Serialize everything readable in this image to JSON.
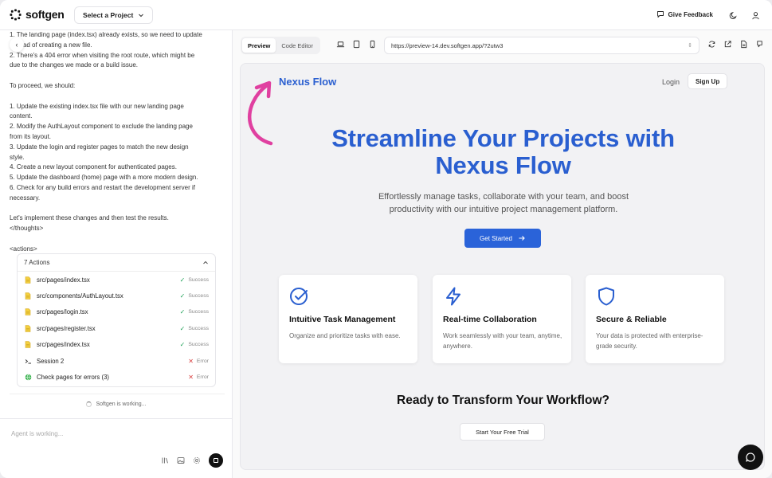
{
  "app": {
    "logo_text": "softgen",
    "project_select": "Select a Project",
    "give_feedback": "Give Feedback"
  },
  "chat": {
    "lines": [
      "1. The landing page (index.tsx) already exists, so we need to update",
      "instead of creating a new file.",
      "2. There's a 404 error when visiting the root route, which might be",
      "due to the changes we made or a build issue.",
      "",
      "To proceed, we should:",
      "",
      "1. Update the existing index.tsx file with our new landing page",
      "content.",
      "2. Modify the AuthLayout component to exclude the landing page",
      "from its layout.",
      "3. Update the login and register pages to match the new design",
      "style.",
      "4. Create a new layout component for authenticated pages.",
      "5. Update the dashboard (home) page with a more modern design.",
      "6. Check for any build errors and restart the development server if",
      "necessary.",
      "",
      "Let's implement these changes and then test the results.",
      "</thoughts>",
      "",
      "<actions>"
    ],
    "actions_title": "7 Actions",
    "actions": [
      {
        "icon": "file-icon",
        "path": "src/pages/index.tsx",
        "status": "Success",
        "ok": true
      },
      {
        "icon": "file-icon",
        "path": "src/components/AuthLayout.tsx",
        "status": "Success",
        "ok": true
      },
      {
        "icon": "file-icon",
        "path": "src/pages/login.tsx",
        "status": "Success",
        "ok": true
      },
      {
        "icon": "file-icon",
        "path": "src/pages/register.tsx",
        "status": "Success",
        "ok": true
      },
      {
        "icon": "file-icon",
        "path": "src/pages/index.tsx",
        "status": "Success",
        "ok": true
      },
      {
        "icon": "terminal-icon",
        "path": "Session 2",
        "status": "Error",
        "ok": false
      },
      {
        "icon": "globe-icon",
        "path": "Check pages for errors (3)",
        "status": "Error",
        "ok": false
      }
    ],
    "working_status": "Softgen is working...",
    "input_placeholder": "Agent is working..."
  },
  "preview_toolbar": {
    "tab_preview": "Preview",
    "tab_code": "Code Editor",
    "url": "https://preview-14.dev.softgen.app/?2utw3"
  },
  "site": {
    "brand": "Nexus Flow",
    "login": "Login",
    "signup": "Sign Up",
    "hero_line1": "Streamline Your Projects with",
    "hero_line2": "Nexus Flow",
    "subtitle_line1": "Effortlessly manage tasks, collaborate with your team, and boost",
    "subtitle_line2": "productivity with our intuitive project management platform.",
    "cta": "Get Started",
    "features": [
      {
        "icon": "check-circle-icon",
        "title": "Intuitive Task Management",
        "desc": "Organize and prioritize tasks with ease."
      },
      {
        "icon": "lightning-icon",
        "title": "Real-time Collaboration",
        "desc": "Work seamlessly with your team, anytime, anywhere."
      },
      {
        "icon": "shield-icon",
        "title": "Secure & Reliable",
        "desc": "Your data is protected with enterprise-grade security."
      }
    ],
    "ready_title": "Ready to Transform Your Workflow?",
    "trial_button": "Start Your Free Trial"
  },
  "colors": {
    "brand_blue": "#2a5fd0",
    "arrow_pink": "#e040a0",
    "success": "#22a35a",
    "error": "#d94040"
  }
}
